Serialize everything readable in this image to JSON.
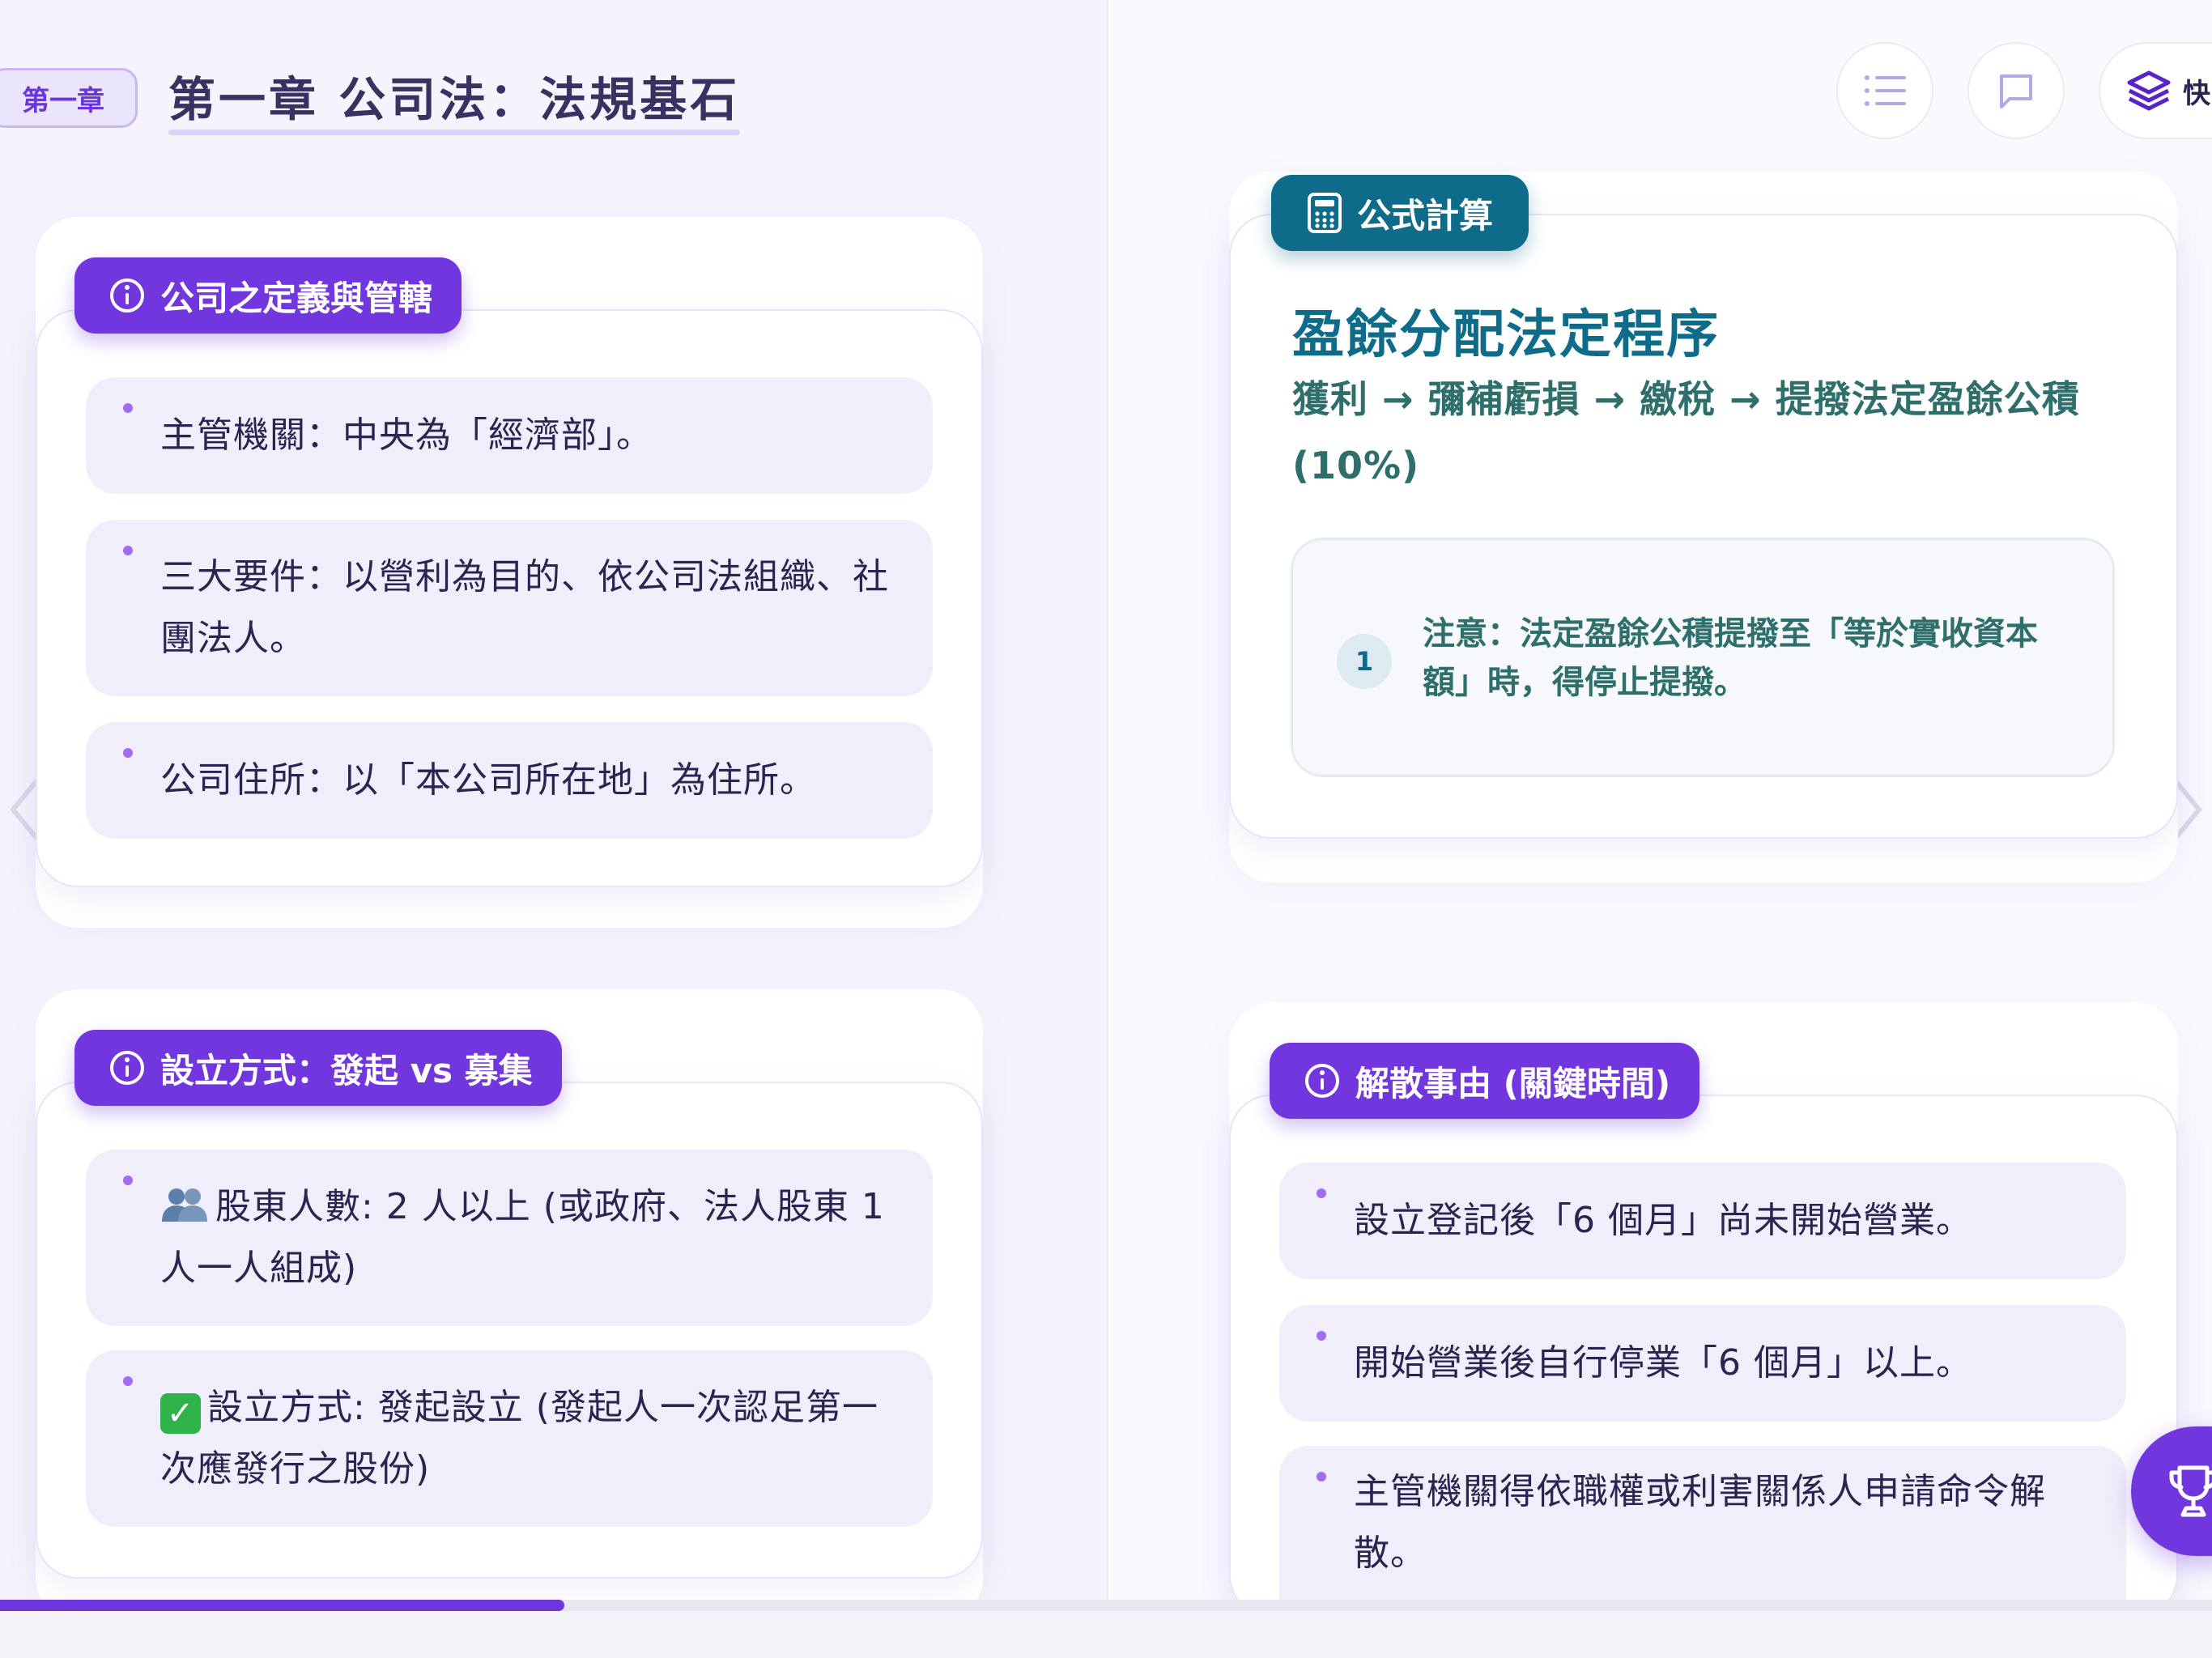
{
  "header": {
    "chapter_badge": "第一章",
    "chapter_title": "第一章 公司法：法規基石",
    "quick_label": "快問"
  },
  "cards": {
    "definition": {
      "title": "公司之定義與管轄",
      "items": [
        "主管機關：中央為「經濟部」。",
        "三大要件：以營利為目的、依公司法組織、社團法人。",
        "公司住所：以「本公司所在地」為住所。"
      ]
    },
    "establishment": {
      "title": "設立方式：發起 vs 募集",
      "items": [
        "股東人數: 2 人以上 (或政府、法人股東 1 人一人組成)",
        "設立方式: 發起設立 (發起人一次認足第一次應發行之股份)"
      ]
    },
    "formula": {
      "pill": "公式計算",
      "title": "盈餘分配法定程序",
      "steps": "獲利 → 彌補虧損 → 繳稅 → 提撥法定盈餘公積 (10%)",
      "note_number": "1",
      "note": "注意：法定盈餘公積提撥至「等於實收資本額」時，得停止提撥。"
    },
    "dissolution": {
      "title": "解散事由 (關鍵時間)",
      "items": [
        "設立登記後「6 個月」尚未開始營業。",
        "開始營業後自行停業「6 個月」以上。",
        "主管機關得依職權或利害關係人申請命令解散。"
      ]
    }
  },
  "progress": {
    "percent": 25.5
  },
  "colors": {
    "accent": "#7236df",
    "teal": "#0e6b8a",
    "item_bg": "#f1eefb"
  },
  "icons": [
    "list-icon",
    "comment-icon",
    "layers-icon",
    "info-icon",
    "calculator-icon",
    "chevron-left-icon",
    "chevron-right-icon",
    "trophy-icon"
  ]
}
